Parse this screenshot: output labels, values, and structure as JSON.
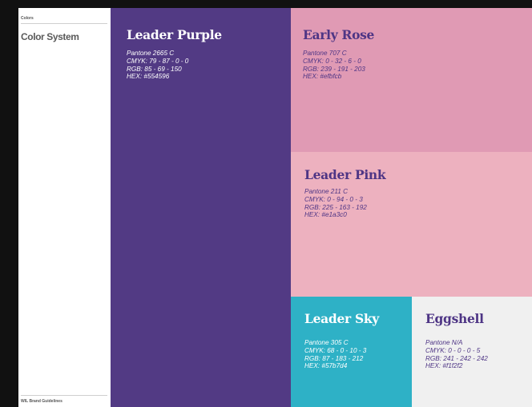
{
  "sidebar": {
    "section_label": "Colors",
    "title": "Color System",
    "footer": "WIL Brand Guidelines"
  },
  "swatches": {
    "leader_purple": {
      "name": "Leader Purple",
      "pantone": "Pantone 2665 C",
      "cmyk": "CMYK: 79 - 87 - 0 - 0",
      "rgb": "RGB: 85 - 69 - 150",
      "hex": "HEX: #554596",
      "color": "#523a84",
      "text_color": "#ffffff"
    },
    "early_rose": {
      "name": "Early Rose",
      "pantone": "Pantone 707 C",
      "cmyk": "CMYK: 0 - 32 - 6 - 0",
      "rgb": "RGB: 239 - 191 - 203",
      "hex": "HEX: #efbfcb",
      "color": "#e09ab4",
      "text_color": "#4e3585"
    },
    "leader_pink": {
      "name": "Leader Pink",
      "pantone": "Pantone 211 C",
      "cmyk": "CMYK: 0 - 94 - 0 - 3",
      "rgb": "RGB: 225 - 163 - 192",
      "hex": "HEX: #e1a3c0",
      "color": "#edb1bf",
      "text_color": "#4e3585"
    },
    "leader_sky": {
      "name": "Leader Sky",
      "pantone": "Pantone 305 C",
      "cmyk": "CMYK: 68 - 0 - 10 - 3",
      "rgb": "RGB: 87 - 183 - 212",
      "hex": "HEX: #57b7d4",
      "color": "#2eb1c6",
      "text_color": "#ffffff"
    },
    "eggshell": {
      "name": "Eggshell",
      "pantone": "Pantone N/A",
      "cmyk": "CMYK: 0 - 0 - 0 - 5",
      "rgb": "RGB: 241 - 242 - 242",
      "hex": "HEX: #f1f2f2",
      "color": "#f0f0f0",
      "text_color": "#4e3585"
    }
  }
}
